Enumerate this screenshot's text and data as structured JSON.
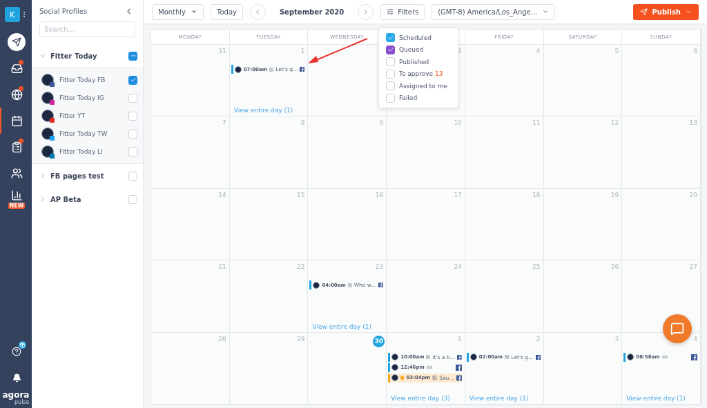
{
  "rail": {
    "account": "K",
    "items": [
      {
        "kind": "publish",
        "active": false,
        "badge": false
      },
      {
        "kind": "inbox",
        "active": false,
        "badge": true
      },
      {
        "kind": "listening",
        "active": false,
        "badge": true
      },
      {
        "kind": "calendar",
        "active": true,
        "badge": false
      },
      {
        "kind": "reports",
        "active": false,
        "badge": true
      },
      {
        "kind": "team",
        "active": false,
        "badge": false
      },
      {
        "kind": "stats",
        "active": false,
        "badge": false,
        "tag": "NEW"
      }
    ],
    "logo": {
      "name": "agora",
      "sub": "pulse"
    }
  },
  "sidebar": {
    "title": "Social Profiles",
    "search": {
      "placeholder": "Search..."
    },
    "groups": [
      {
        "name": "Fitter Today",
        "expanded": true,
        "partial": true,
        "profiles": [
          {
            "name": "Fitter Today FB",
            "kind": "facebook",
            "checked": true
          },
          {
            "name": "Fitter Today IG",
            "kind": "instagram",
            "checked": false
          },
          {
            "name": "Fitter YT",
            "kind": "youtube",
            "checked": false
          },
          {
            "name": "Fitter Today TW",
            "kind": "twitter",
            "checked": false
          },
          {
            "name": "Fitter Today LI",
            "kind": "linkedin",
            "checked": false
          }
        ]
      },
      {
        "name": "FB pages test",
        "expanded": false,
        "checked": false,
        "partial": false
      },
      {
        "name": "AP Beta",
        "expanded": false,
        "checked": false,
        "partial": false
      }
    ]
  },
  "toolbar": {
    "view": "Monthly",
    "today": "Today",
    "month": "September 2020",
    "filters": "Filters",
    "timezone": "(GMT-8) America/Los_Ange…",
    "publish": "Publish"
  },
  "filters": [
    {
      "label": "Scheduled",
      "checked": true,
      "color": "#29a8e8"
    },
    {
      "label": "Queued",
      "checked": true,
      "color": "#8a4fd0"
    },
    {
      "label": "Published",
      "checked": false
    },
    {
      "label": "To approve",
      "checked": false,
      "count": "13"
    },
    {
      "label": "Assigned to me",
      "checked": false
    },
    {
      "label": "Failed",
      "checked": false
    }
  ],
  "calendar": {
    "weekdays": {
      "mon": "MONDAY",
      "tue": "TUESDAY",
      "wed": "WEDNESDAY",
      "fri": "FRIDAY",
      "sat": "SATURDAY",
      "sun": "SUNDAY"
    },
    "weeks": [
      {
        "mon": {
          "day": "31"
        },
        "tue": {
          "day": "1",
          "posts": [
            {
              "time": "07:00am",
              "kind": "image",
              "text": "Let's g…",
              "queued": false
            }
          ],
          "more": "View entire day (1)"
        },
        "thu": {
          "day": "3"
        },
        "fri": {
          "day": "4"
        },
        "sat": {
          "day": "5"
        },
        "sun": {
          "day": "6"
        }
      },
      {
        "mon": {
          "day": "7"
        },
        "tue": {
          "day": "8"
        },
        "wed": {
          "day": "9"
        },
        "thu": {
          "day": "10"
        },
        "fri": {
          "day": "11"
        },
        "sat": {
          "day": "12"
        },
        "sun": {
          "day": "13"
        }
      },
      {
        "mon": {
          "day": "14"
        },
        "tue": {
          "day": "15"
        },
        "wed": {
          "day": "16"
        },
        "thu": {
          "day": "17"
        },
        "fri": {
          "day": "18"
        },
        "sat": {
          "day": "19"
        },
        "sun": {
          "day": "20"
        }
      },
      {
        "mon": {
          "day": "21"
        },
        "tue": {
          "day": "22"
        },
        "wed": {
          "day": "23",
          "posts": [
            {
              "time": "04:00am",
              "kind": "image",
              "text": "Who w…",
              "queued": false
            }
          ],
          "more": "View entire day (1)"
        },
        "thu": {
          "day": "24"
        },
        "fri": {
          "day": "25"
        },
        "sat": {
          "day": "26"
        },
        "sun": {
          "day": "27"
        }
      },
      {
        "mon": {
          "day": "28"
        },
        "tue": {
          "day": "29"
        },
        "wed": {
          "day": "30",
          "today": true
        },
        "thu": {
          "day": "1",
          "posts": [
            {
              "time": "10:00am",
              "kind": "image",
              "text": "It's a b…",
              "queued": false
            },
            {
              "time": "12:46pm",
              "kind": "link",
              "queued": false
            },
            {
              "time": "03:04pm",
              "kind": "image",
              "text": "Sau…",
              "queued": true
            }
          ],
          "more": "View entire day (3)"
        },
        "fri": {
          "day": "2",
          "posts": [
            {
              "time": "02:00am",
              "kind": "image",
              "text": "Let's g…",
              "queued": false
            }
          ],
          "more": "View entire day (1)"
        },
        "sat": {
          "day": "3"
        },
        "sun": {
          "day": "4",
          "posts": [
            {
              "time": "08:58am",
              "kind": "link",
              "queued": false
            }
          ],
          "more": "View entire day (1)"
        }
      }
    ]
  }
}
